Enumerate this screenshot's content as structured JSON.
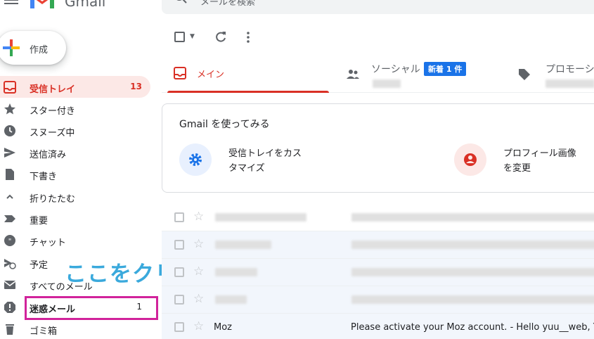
{
  "app": {
    "logo_text": "Gmail",
    "search_placeholder": "メールを検索"
  },
  "compose": {
    "label": "作成"
  },
  "sidebar": {
    "items": [
      {
        "label": "受信トレイ",
        "count": "13"
      },
      {
        "label": "スター付き",
        "count": ""
      },
      {
        "label": "スヌーズ中",
        "count": ""
      },
      {
        "label": "送信済み",
        "count": ""
      },
      {
        "label": "下書き",
        "count": ""
      },
      {
        "label": "折りたたむ",
        "count": ""
      },
      {
        "label": "重要",
        "count": ""
      },
      {
        "label": "チャット",
        "count": ""
      },
      {
        "label": "予定",
        "count": ""
      },
      {
        "label": "すべてのメール",
        "count": ""
      },
      {
        "label": "迷惑メール",
        "count": "1"
      },
      {
        "label": "ゴミ箱",
        "count": ""
      }
    ]
  },
  "annotation": {
    "text": "ここをクリック",
    "color": "#3aa9dc",
    "box_color": "#d1239b"
  },
  "tabs": [
    {
      "label": "メイン",
      "badge": ""
    },
    {
      "label": "ソーシャル",
      "badge": "新着 1 件"
    },
    {
      "label": "プロモーション",
      "badge": ""
    }
  ],
  "card": {
    "title": "Gmail を使ってみる",
    "items": [
      {
        "line1": "受信トレイをカス",
        "line2": "タマイズ",
        "icon": "gear-icon",
        "color": "#1a73e8"
      },
      {
        "line1": "プロフィール画像",
        "line2": "を変更",
        "icon": "account-icon",
        "color": "#d93025"
      }
    ]
  },
  "emails": [
    {
      "sender": "",
      "subject": ""
    },
    {
      "sender": "",
      "subject": ""
    },
    {
      "sender": "",
      "subject": ""
    },
    {
      "sender": "",
      "subject": ""
    },
    {
      "sender": "Moz",
      "subject": "Please activate your Moz account. - Hello yuu__web, Yo"
    }
  ],
  "colors": {
    "accent_red": "#d93025",
    "accent_blue": "#1a73e8",
    "active_bg": "#fce8e6"
  }
}
